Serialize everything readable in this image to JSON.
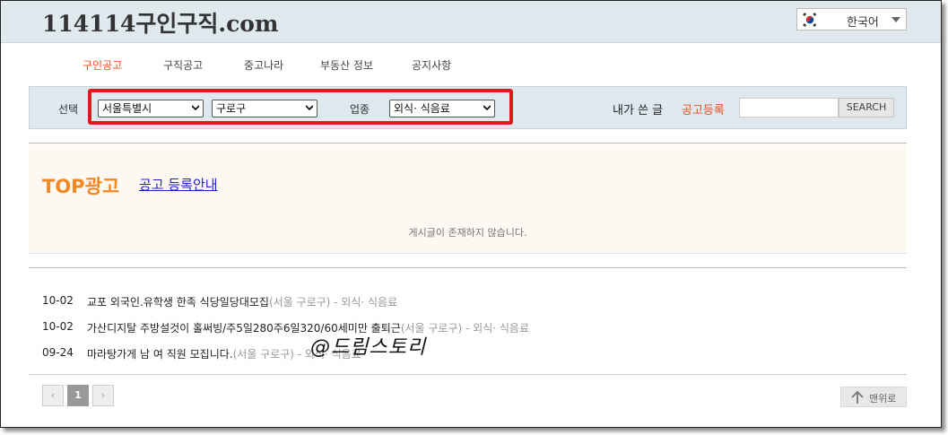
{
  "header": {
    "logo": "114114구인구직.com",
    "language": {
      "label": "한국어",
      "flag_icon": "korea-flag-icon"
    }
  },
  "nav": {
    "items": [
      {
        "label": "구인공고",
        "active": true
      },
      {
        "label": "구직공고",
        "active": false
      },
      {
        "label": "중고나라",
        "active": false
      },
      {
        "label": "부동산 정보",
        "active": false
      },
      {
        "label": "공지사항",
        "active": false
      }
    ]
  },
  "filter": {
    "select_label": "선택",
    "region": "서울특별시",
    "district": "구로구",
    "category_label": "업종",
    "category": "외식· 식음료",
    "my_posts": "내가 쓴 글",
    "register_ad": "공고등록",
    "search_placeholder": "",
    "search_button": "SEARCH",
    "highlight_color": "#e0191e"
  },
  "top_ad": {
    "title": "TOP광고",
    "link": "공고 등록안내",
    "empty_message": "게시글이 존재하지 않습니다."
  },
  "listings": [
    {
      "date": "10-02",
      "title": "교포 외국인.유학생 한족 식당일당대모집",
      "meta": "(서울 구로구) - 외식· 식음료"
    },
    {
      "date": "10-02",
      "title": "가산디지탈 주방설것이 홀써빙/주5일280주6일320/60세미만 출퇴근",
      "meta": "(서울 구로구) - 외식· 식음료"
    },
    {
      "date": "09-24",
      "title": "마라탕가게 남 여 직원 모집니다.",
      "meta": "(서울 구로구) - 외식· 식음료"
    }
  ],
  "pagination": {
    "prev": "‹",
    "current": "1",
    "next": "›"
  },
  "back_to_top": "맨위로",
  "watermark": "@드림스토리",
  "colors": {
    "accent": "#e8501f",
    "top_ad": "#f08826",
    "topbar": "#dfe9ee"
  }
}
